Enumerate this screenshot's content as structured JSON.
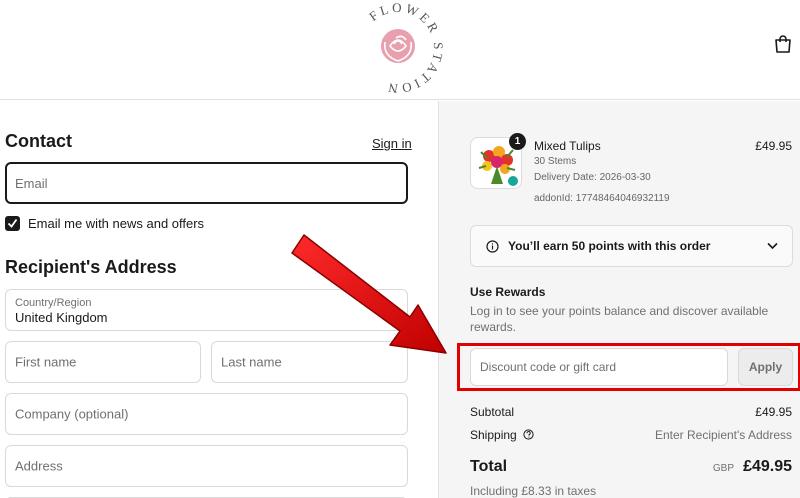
{
  "header": {
    "logo_text": "FLOWER STATION",
    "logo_icon": "rose-logo",
    "cart_icon": "shopping-bag-icon"
  },
  "contact": {
    "title": "Contact",
    "sign_in": "Sign in",
    "email_placeholder": "Email",
    "news_checkbox_checked": true,
    "news_label": "Email me with news and offers"
  },
  "recipient": {
    "title": "Recipient's Address",
    "country_label": "Country/Region",
    "country_value": "United Kingdom",
    "first_name_placeholder": "First name",
    "last_name_placeholder": "Last name",
    "company_placeholder": "Company (optional)",
    "address_placeholder": "Address"
  },
  "order": {
    "product": {
      "quantity": "1",
      "name": "Mixed Tulips",
      "stems": "30 Stems",
      "delivery": "Delivery Date: 2026-03-30",
      "addon": "addonId: 17748464046932119",
      "price": "£49.95"
    },
    "points_message": "You’ll earn 50 points with this order",
    "rewards": {
      "title": "Use Rewards",
      "description": "Log in to see your points balance and discover available rewards."
    },
    "discount": {
      "placeholder": "Discount code or gift card",
      "apply_label": "Apply"
    },
    "subtotal_label": "Subtotal",
    "subtotal_value": "£49.95",
    "shipping_label": "Shipping",
    "shipping_value": "Enter Recipient's Address",
    "total_label": "Total",
    "total_currency": "GBP",
    "total_value": "£49.95",
    "tax_line": "Including £8.33 in taxes"
  },
  "colors": {
    "annotation_red": "#e10000",
    "logo_pink": "#e8a0ae"
  }
}
